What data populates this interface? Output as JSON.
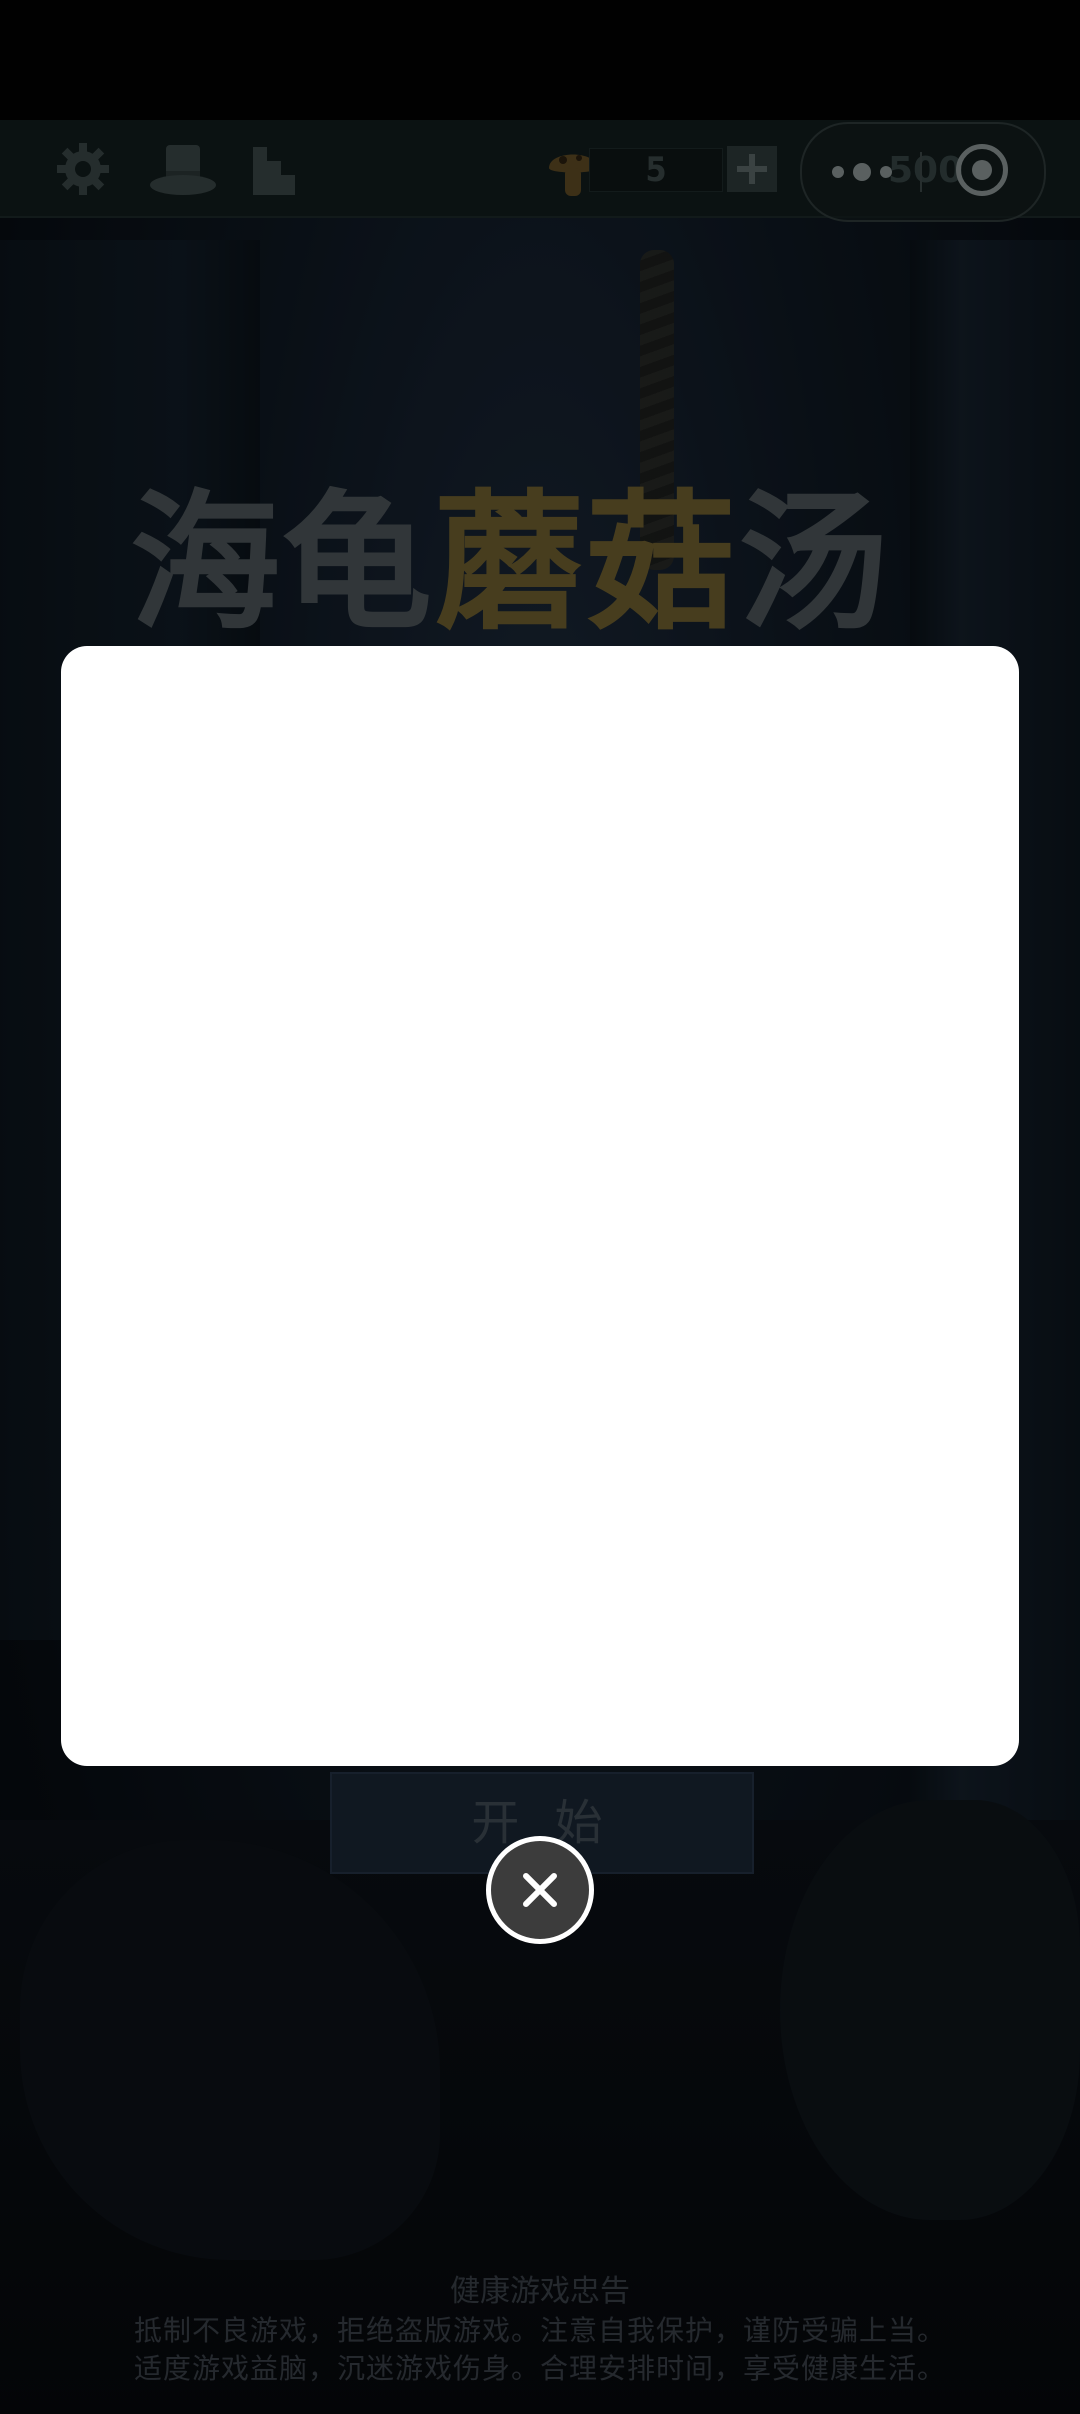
{
  "top_bar": {
    "icons": [
      "gear-icon",
      "hat-icon",
      "stairs-icon",
      "mushroom-icon",
      "plus-icon"
    ],
    "currency_count": "5"
  },
  "capsule": {
    "score": "500",
    "icons": [
      "more-dots-icon",
      "target-icon"
    ]
  },
  "title": {
    "part1": "海龟",
    "part2": "蘑菇",
    "part3": "汤"
  },
  "start_button_label": "开 始",
  "advisory": {
    "title": "健康游戏忠告",
    "line1": "抵制不良游戏，拒绝盗版游戏。注意自我保护，谨防受骗上当。",
    "line2": "适度游戏益脑，沉迷游戏伤身。合理安排时间，享受健康生活。"
  },
  "modal": {
    "close_icon": "close-icon"
  },
  "colors": {
    "modal_bg": "#ffffff",
    "close_bg": "#3c3c3c",
    "title_gold": "#6e5e2e"
  }
}
